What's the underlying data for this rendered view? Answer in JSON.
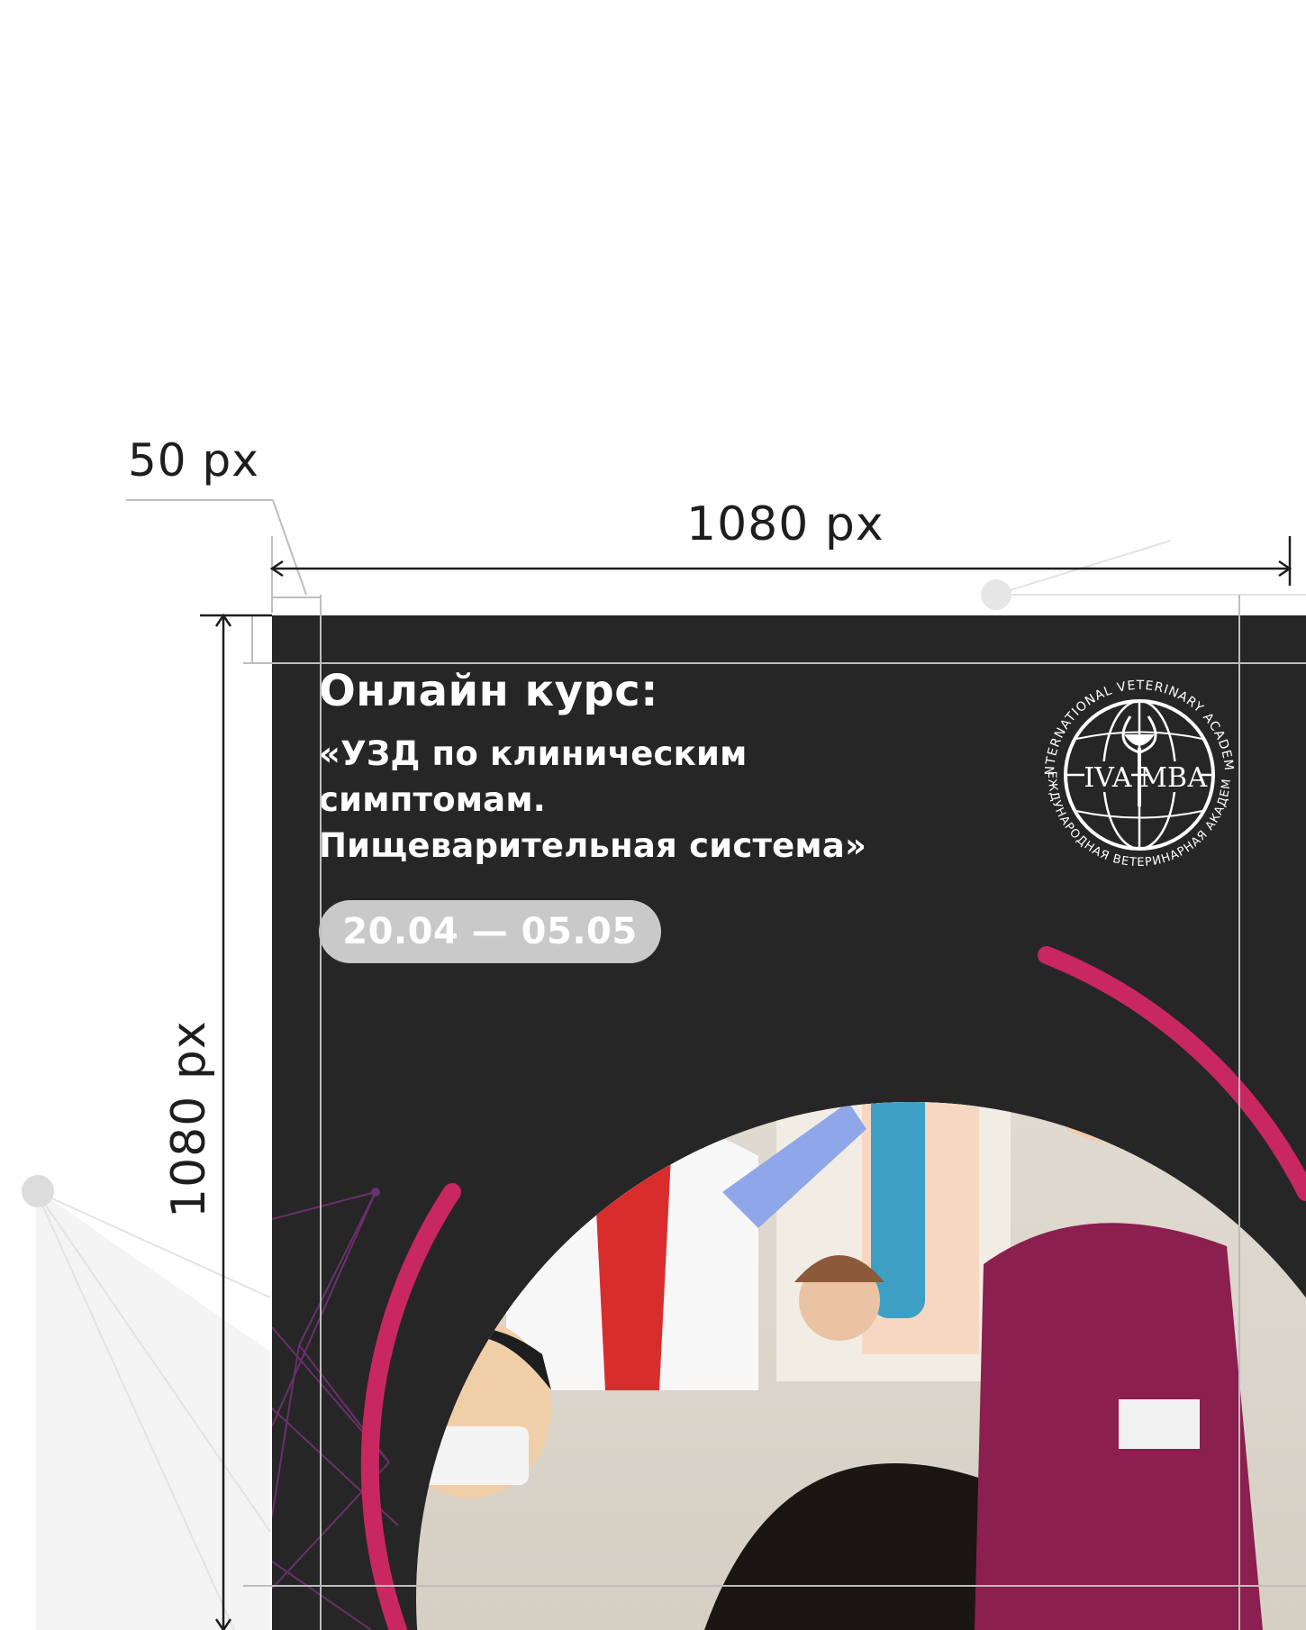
{
  "dimensions": {
    "margin_label": "50 px",
    "width_label": "1080 px",
    "height_label": "1080 px"
  },
  "poster": {
    "title": "Онлайн курс:",
    "subtitle_lines": [
      "«УЗД по клиническим",
      "симптомам.",
      "Пищеварительная система»"
    ],
    "date_range": "20.04 — 05.05"
  },
  "logo": {
    "ring_text_top": "INTERNATIONAL VETERINARY ACADEMY",
    "ring_text_bottom": "МЕЖДУНАРОДНАЯ ВЕТЕРИНАРНАЯ АКАДЕМИЯ",
    "left_mark": "IVA",
    "right_mark": "МВА"
  },
  "colors": {
    "poster_bg": "#262626",
    "accent": "#c8275f",
    "pill": "#c9c9c9",
    "guide": "#bdbdbd",
    "network": "#6a2f6d"
  }
}
